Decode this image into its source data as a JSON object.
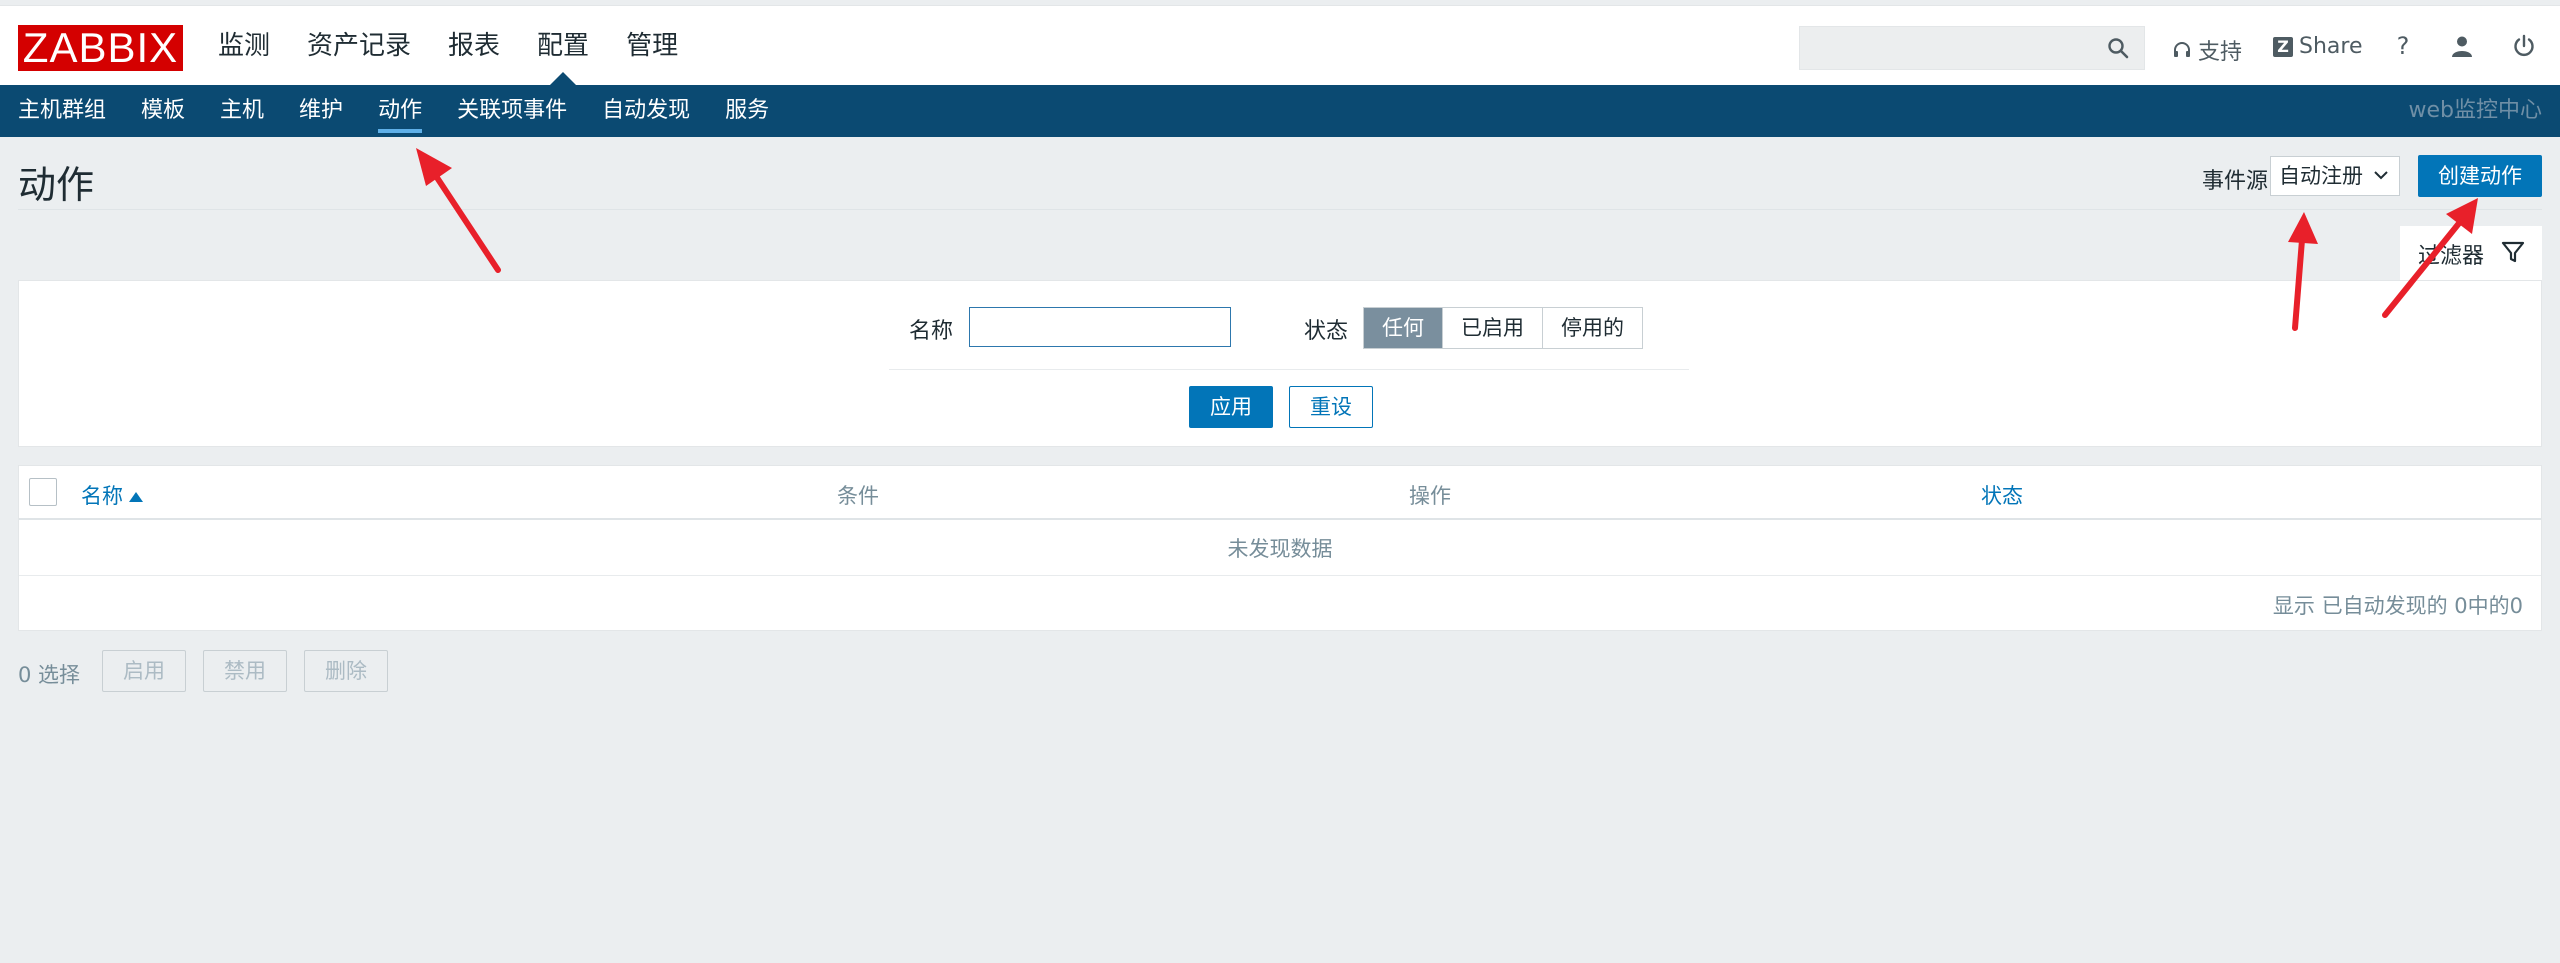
{
  "brand": {
    "logo_text": "ZABBIX",
    "site_name": "web监控中心"
  },
  "main_nav": [
    {
      "label": "监测"
    },
    {
      "label": "资产记录"
    },
    {
      "label": "报表"
    },
    {
      "label": "配置",
      "active": true
    },
    {
      "label": "管理"
    }
  ],
  "header": {
    "search_placeholder": "",
    "support_label": "支持",
    "share_label": "Share",
    "share_badge": "Z",
    "help_label": "?",
    "icons": [
      "search-icon",
      "headset-icon",
      "help-icon",
      "user-icon",
      "power-icon"
    ]
  },
  "sub_nav": [
    {
      "label": "主机群组"
    },
    {
      "label": "模板"
    },
    {
      "label": "主机"
    },
    {
      "label": "维护"
    },
    {
      "label": "动作",
      "active": true
    },
    {
      "label": "关联项事件"
    },
    {
      "label": "自动发现"
    },
    {
      "label": "服务"
    }
  ],
  "page": {
    "title": "动作",
    "event_source_label": "事件源",
    "event_source_value": "自动注册",
    "create_button": "创建动作"
  },
  "filter": {
    "tab_label": "过滤器",
    "name_label": "名称",
    "name_value": "",
    "status_label": "状态",
    "status_options": [
      {
        "label": "任何",
        "selected": true
      },
      {
        "label": "已启用",
        "selected": false
      },
      {
        "label": "停用的",
        "selected": false
      }
    ],
    "apply_label": "应用",
    "reset_label": "重设"
  },
  "table": {
    "columns": [
      {
        "label": "名称",
        "sortable": true
      },
      {
        "label": "条件"
      },
      {
        "label": "操作"
      },
      {
        "label": "状态",
        "sortable": true
      }
    ],
    "empty_text": "未发现数据",
    "stats_text": "显示 已自动发现的 0中的0"
  },
  "mass_actions": {
    "selected_text": "0 选择",
    "buttons": [
      {
        "label": "启用"
      },
      {
        "label": "禁用"
      },
      {
        "label": "删除"
      }
    ]
  },
  "colors": {
    "logo_bg": "#d40000",
    "subnav_bg": "#0b4a72",
    "primary": "#0275b8",
    "annotation": "#e8202a"
  }
}
